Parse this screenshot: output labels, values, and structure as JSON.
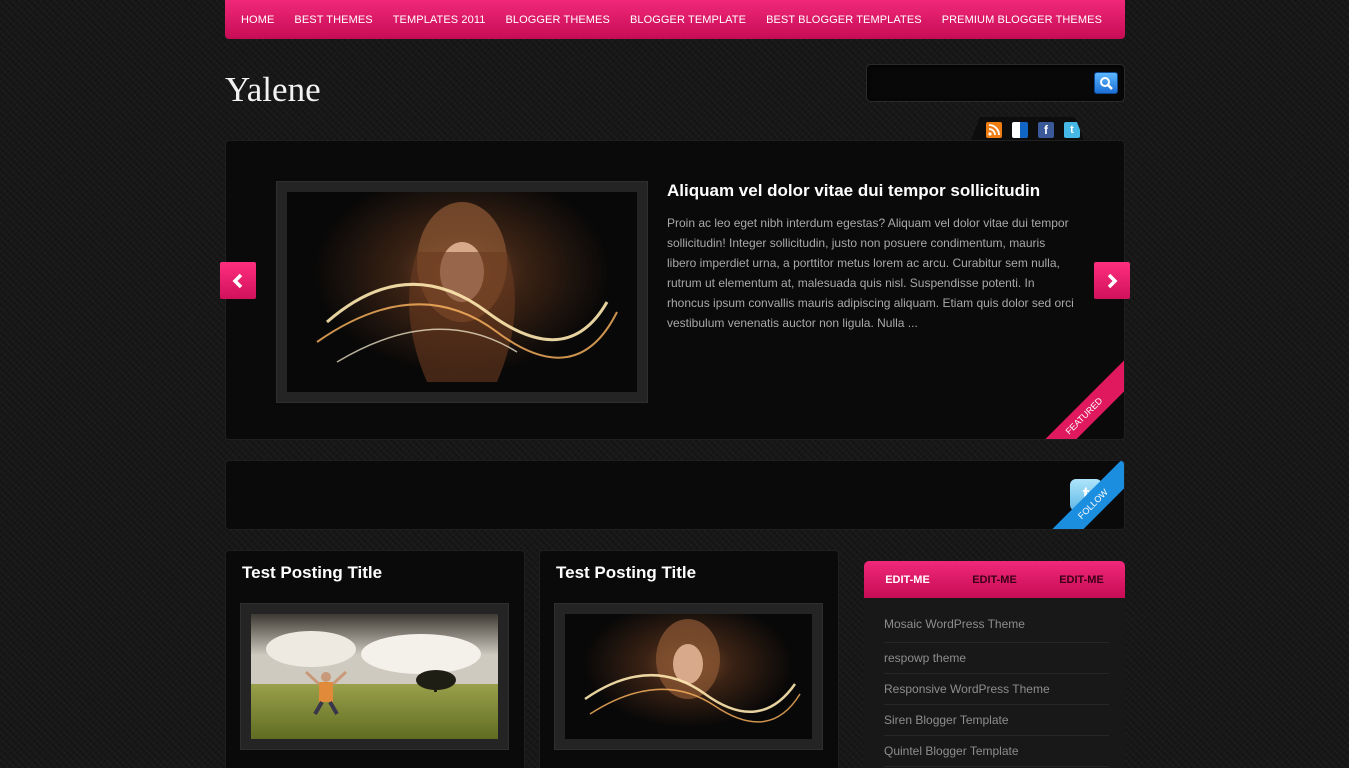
{
  "nav": {
    "items": [
      "HOME",
      "BEST THEMES",
      "TEMPLATES 2011",
      "BLOGGER THEMES",
      "BLOGGER TEMPLATE",
      "BEST BLOGGER TEMPLATES",
      "PREMIUM BLOGGER THEMES"
    ]
  },
  "site": {
    "title": "Yalene"
  },
  "search": {
    "value": "",
    "placeholder": ""
  },
  "social": {
    "icons": [
      "rss-icon",
      "delicious-icon",
      "facebook-icon",
      "twitter-icon"
    ]
  },
  "slider": {
    "title": "Aliquam vel dolor vitae dui tempor sollicitudin",
    "excerpt": "Proin ac leo eget nibh interdum egestas? Aliquam vel dolor vitae dui tempor sollicitudin! Integer sollicitudin, justo non posuere condimentum, mauris libero imperdiet urna, a porttitor metus lorem ac arcu. Curabitur sem nulla, rutrum ut elementum at, malesuada quis nisl. Suspendisse potenti. In rhoncus ipsum convallis mauris adipiscing aliquam. Etiam quis dolor sed orci vestibulum venenatis auctor non ligula. Nulla ...",
    "ribbon": "FEATURED"
  },
  "twitter": {
    "ribbon": "FOLLOW"
  },
  "posts": [
    {
      "title": "Test Posting Title"
    },
    {
      "title": "Test Posting Title"
    }
  ],
  "sidebar": {
    "tabs": [
      "EDIT-ME",
      "EDIT-ME",
      "EDIT-ME"
    ],
    "links": [
      "Mosaic WordPress Theme",
      "respowp theme",
      "Responsive WordPress Theme",
      "Siren Blogger Template",
      "Quintel Blogger Template"
    ]
  },
  "colors": {
    "accent": "#e0195f",
    "background": "#171717",
    "panel": "#0a0a0a",
    "twitter": "#1c8ee0"
  }
}
